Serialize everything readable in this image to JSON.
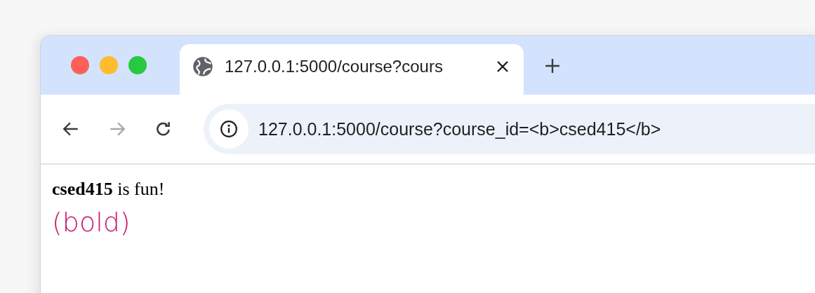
{
  "tabs": [
    {
      "title": "127.0.0.1:5000/course?cours",
      "selected": true
    }
  ],
  "nav_buttons": [
    {
      "kind": "back",
      "disabled": false
    },
    {
      "kind": "forward",
      "disabled": true
    },
    {
      "kind": "reload",
      "disabled": false
    }
  ],
  "address_bar": {
    "value": "127.0.0.1:5000/course?course_id=<b>csed415</b>"
  },
  "page": {
    "text": "**csed415** is fun!"
  },
  "annotation": "(bold)"
}
